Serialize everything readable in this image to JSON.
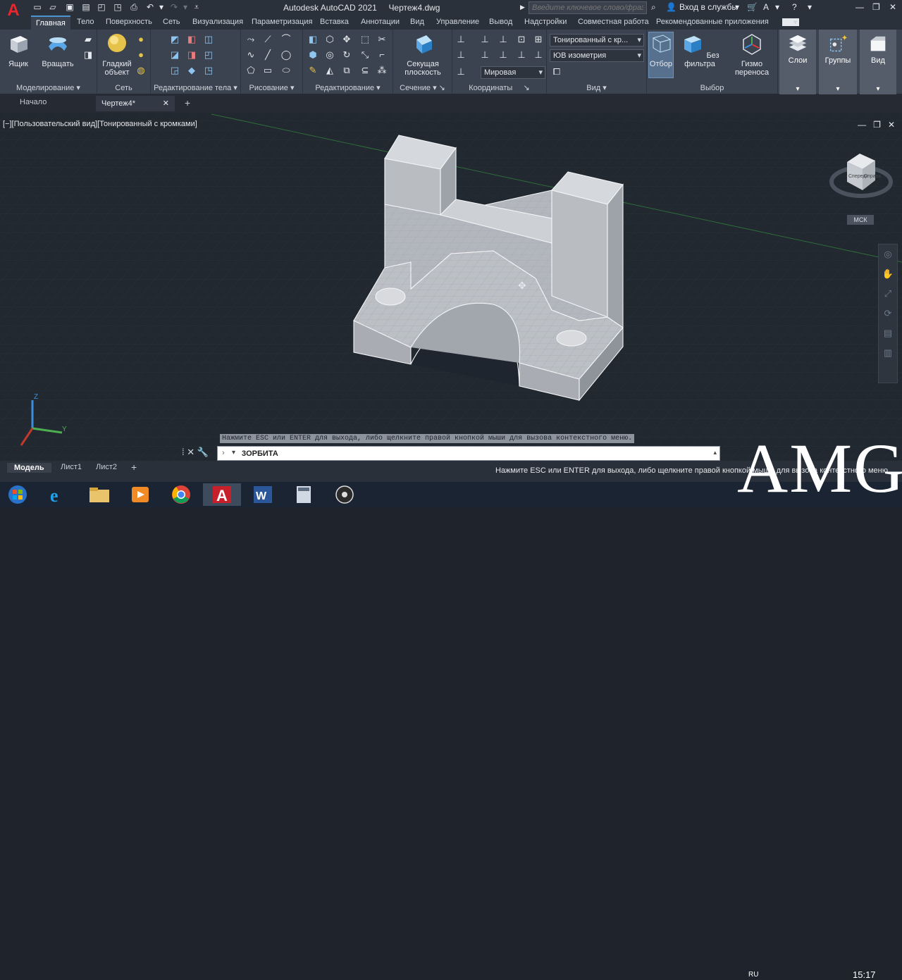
{
  "titlebar": {
    "app_title": "Autodesk AutoCAD 2021",
    "file_name": "Чертеж4.dwg",
    "search_placeholder": "Введите ключевое слово/фразу",
    "signin_label": "Вход в службы"
  },
  "ribbon_tabs": [
    "Главная",
    "Тело",
    "Поверхность",
    "Сеть",
    "Визуализация",
    "Параметризация",
    "Вставка",
    "Аннотации",
    "Вид",
    "Управление",
    "Вывод",
    "Надстройки",
    "Совместная работа",
    "Рекомендованные приложения"
  ],
  "ribbon": {
    "modeling": {
      "box_label": "Ящик",
      "revolve_label": "Вращать",
      "panel": "Моделирование"
    },
    "mesh": {
      "smooth_label": "Гладкий объект",
      "panel": "Сеть"
    },
    "solid_edit": {
      "panel": "Редактирование тела"
    },
    "draw": {
      "panel": "Рисование"
    },
    "modify": {
      "panel": "Редактирование"
    },
    "section": {
      "plane_label": "Секущая плоскость",
      "panel": "Сечение"
    },
    "coords": {
      "ucs_combo": "Мировая",
      "panel": "Координаты"
    },
    "view": {
      "visual_style_combo": "Тонированный с кр...",
      "view_combo": "ЮВ изометрия",
      "panel": "Вид"
    },
    "selection": {
      "culling_label": "Отбор",
      "no_filter_label": "Без фильтра",
      "gizmo_label": "Гизмо переноса",
      "panel": "Выбор"
    },
    "layers_label": "Слои",
    "groups_label": "Группы",
    "view_label": "Вид"
  },
  "doc_tabs": {
    "start": "Начало",
    "drawing": "Чертеж4*"
  },
  "viewport": {
    "label": "[−][Пользовательский вид][Тонированный с кромками]",
    "viewcube_face_front": "Спереди",
    "viewcube_face_right": "Справа",
    "ucs_badge": "МСК",
    "axis_z": "Z",
    "axis_y": "Y"
  },
  "command": {
    "tip": "Нажмите ESC или ENTER для выхода, либо щелкните правой кнопкой мыши для вызова контекстного меню.",
    "input_value": "3ОРБИТА"
  },
  "layout_tabs": [
    "Модель",
    "Лист1",
    "Лист2"
  ],
  "status_text": "Нажмите ESC или ENTER для выхода, либо щелкните правой кнопкой мыши для вызова контекстного меню.",
  "taskbar": {
    "lang": "RU",
    "clock": "15:17"
  },
  "watermark": "AMG",
  "colors": {
    "accent": "#4b95d1",
    "brand": "#e8262b",
    "background": "#212830"
  }
}
